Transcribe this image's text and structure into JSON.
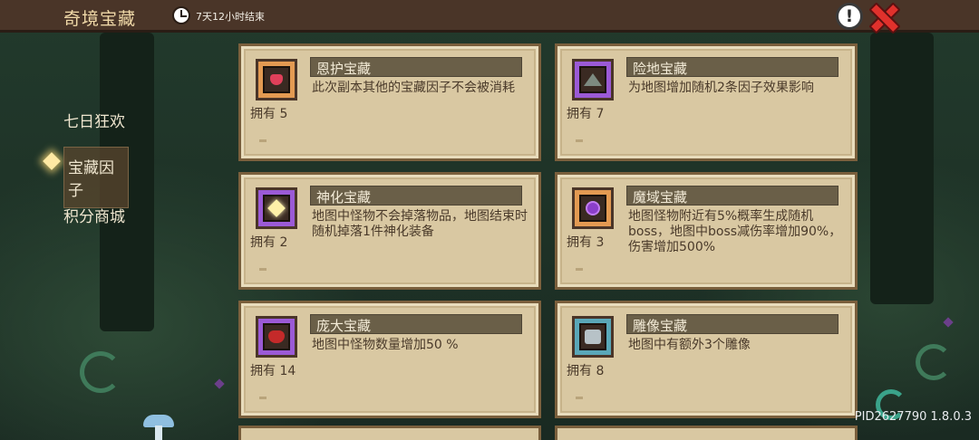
{
  "header": {
    "title": "奇境宝藏",
    "timer": "7天12小时结束",
    "info_icon": "exclamation-icon",
    "close_icon": "close-icon"
  },
  "sidebar": {
    "items": [
      {
        "label": "七日狂欢",
        "active": false
      },
      {
        "label": "宝藏因子",
        "active": true
      },
      {
        "label": "积分商城",
        "active": false
      }
    ]
  },
  "cards": [
    {
      "title": "恩护宝藏",
      "desc": "此次副本其他的宝藏因子不会被消耗",
      "owned": "拥有 5",
      "icon": "heart-shield-icon",
      "frame": "orange"
    },
    {
      "title": "险地宝藏",
      "desc": "为地图增加随机2条因子效果影响",
      "owned": "拥有 7",
      "icon": "mound-icon",
      "frame": "purple"
    },
    {
      "title": "神化宝藏",
      "desc": "地图中怪物不会掉落物品，地图结束时随机掉落1件神化装备",
      "owned": "拥有 2",
      "icon": "sparkle-icon",
      "frame": "purple"
    },
    {
      "title": "魔域宝藏",
      "desc": "地图怪物附近有5%概率生成随机boss，地图中boss减伤率增加90%，伤害增加500%",
      "owned": "拥有 3",
      "icon": "dark-orb-icon",
      "frame": "orange"
    },
    {
      "title": "庞大宝藏",
      "desc": "地图中怪物数量增加50 %",
      "owned": "拥有 14",
      "icon": "demon-face-icon",
      "frame": "purple"
    },
    {
      "title": "雕像宝藏",
      "desc": "地图中有额外3个雕像",
      "owned": "拥有 8",
      "icon": "statue-icon",
      "frame": "blue"
    }
  ],
  "footer": {
    "version": "PID2627790 1.8.0.3"
  },
  "colors": {
    "panel": "#d9c8a2",
    "title_bar": "#6a5f48",
    "header": "#4a3528"
  }
}
